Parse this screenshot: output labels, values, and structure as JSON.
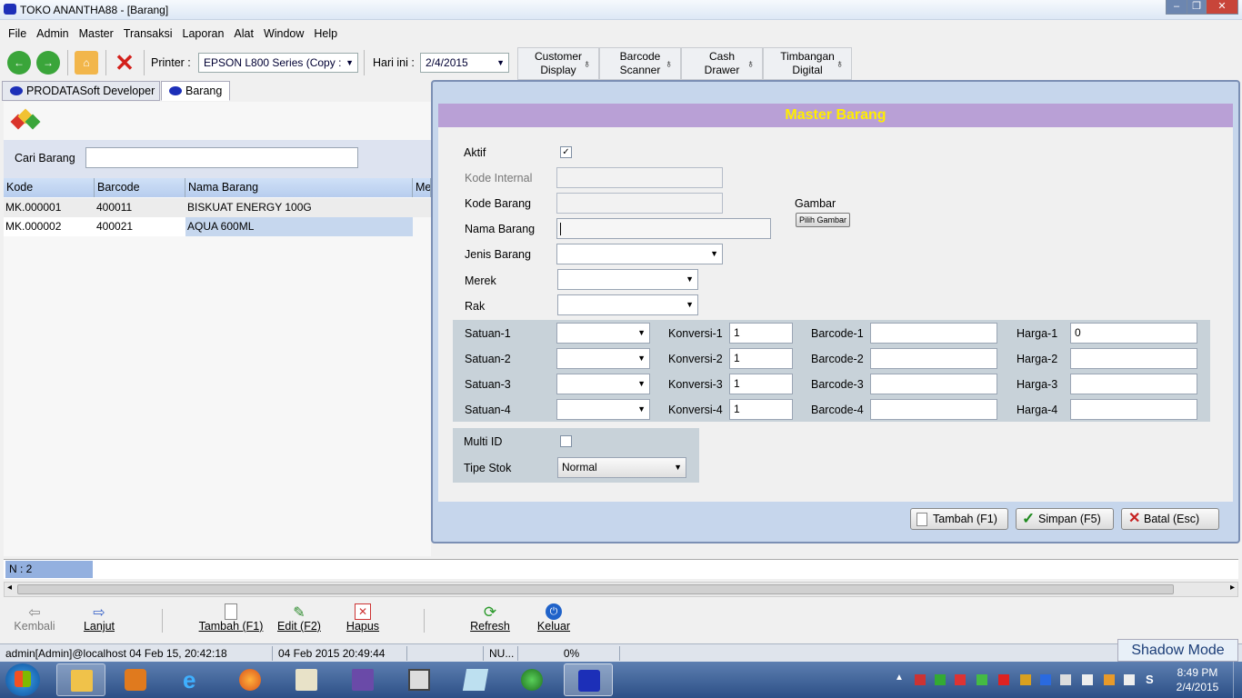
{
  "window": {
    "title": "TOKO ANANTHA88 - [Barang]"
  },
  "menu": [
    "File",
    "Admin",
    "Master",
    "Transaksi",
    "Laporan",
    "Alat",
    "Window",
    "Help"
  ],
  "toolbar": {
    "printer_label": "Printer :",
    "printer_value": "EPSON L800 Series (Copy :",
    "date_label": "Hari ini :",
    "date_value": "2/4/2015",
    "hardware": [
      {
        "line1": "Customer",
        "line2": "Display"
      },
      {
        "line1": "Barcode",
        "line2": "Scanner"
      },
      {
        "line1": "Cash",
        "line2": "Drawer"
      },
      {
        "line1": "Timbangan",
        "line2": "Digital"
      }
    ]
  },
  "tabs": [
    "PRODATASoft Developer",
    "Barang"
  ],
  "search": {
    "label": "Cari Barang",
    "value": ""
  },
  "grid": {
    "columns": [
      "Kode",
      "Barcode",
      "Nama Barang",
      "Me"
    ],
    "rows": [
      {
        "kode": "MK.000001",
        "barcode": "400011",
        "nama": "BISKUAT ENERGY 100G"
      },
      {
        "kode": "MK.000002",
        "barcode": "400021",
        "nama": "AQUA 600ML"
      }
    ]
  },
  "dialog": {
    "title": "Master Barang",
    "aktif_label": "Aktif",
    "aktif_checked": true,
    "kode_internal_label": "Kode Internal",
    "kode_barang_label": "Kode Barang",
    "nama_barang_label": "Nama Barang",
    "jenis_barang_label": "Jenis Barang",
    "merek_label": "Merek",
    "rak_label": "Rak",
    "gambar_label": "Gambar",
    "pilih_gambar": "Pilih Gambar",
    "units": [
      {
        "satuan": "Satuan-1",
        "konversi_label": "Konversi-1",
        "konversi": "1",
        "barcode_label": "Barcode-1",
        "harga_label": "Harga-1",
        "harga": "0"
      },
      {
        "satuan": "Satuan-2",
        "konversi_label": "Konversi-2",
        "konversi": "1",
        "barcode_label": "Barcode-2",
        "harga_label": "Harga-2",
        "harga": ""
      },
      {
        "satuan": "Satuan-3",
        "konversi_label": "Konversi-3",
        "konversi": "1",
        "barcode_label": "Barcode-3",
        "harga_label": "Harga-3",
        "harga": ""
      },
      {
        "satuan": "Satuan-4",
        "konversi_label": "Konversi-4",
        "konversi": "1",
        "barcode_label": "Barcode-4",
        "harga_label": "Harga-4",
        "harga": ""
      }
    ],
    "multi_id_label": "Multi ID",
    "multi_id_checked": false,
    "tipe_stok_label": "Tipe Stok",
    "tipe_stok_value": "Normal",
    "btn_tambah": "Tambah (F1)",
    "btn_simpan": "Simpan (F5)",
    "btn_batal": "Batal (Esc)"
  },
  "count_label": "N : 2",
  "bottom_toolbar": [
    "Kembali",
    "Lanjut",
    "Tambah (F1)",
    "Edit (F2)",
    "Hapus",
    "Refresh",
    "Keluar"
  ],
  "status": {
    "user": "admin[Admin]@localhost 04 Feb 15, 20:42:18",
    "datetime": "04 Feb 2015 20:49:44",
    "num": "NU...",
    "percent": "0%"
  },
  "shadow_mode": "Shadow Mode",
  "clock": {
    "time": "8:49 PM",
    "date": "2/4/2015"
  },
  "colors": {
    "dialog_header": "#b9a0d6",
    "dialog_title": "#ffee00",
    "taskbar": "#2c4f86"
  }
}
